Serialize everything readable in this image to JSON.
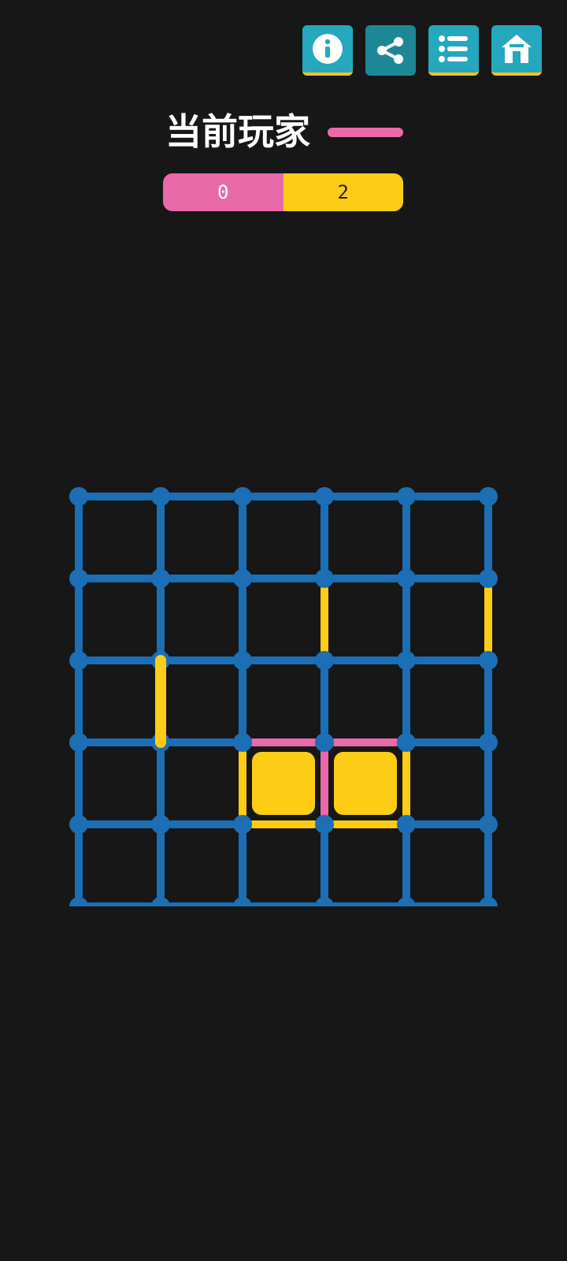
{
  "header": {
    "buttons": [
      {
        "name": "info-button",
        "icon": "info-icon"
      },
      {
        "name": "share-button",
        "icon": "share-icon"
      },
      {
        "name": "list-button",
        "icon": "list-icon"
      },
      {
        "name": "home-button",
        "icon": "home-icon"
      }
    ],
    "player_label": "当前玩家",
    "current_player": 1
  },
  "scores": {
    "player1": "0",
    "player2": "2"
  },
  "colors": {
    "background": "#171717",
    "grid_line": "#1c6fb5",
    "player1": "#e96aa8",
    "player2": "#fdcd15",
    "button": "#25a8bd",
    "button_dark": "#1e8797",
    "button_underline": "#f2c419"
  },
  "board": {
    "dots_per_side": 6,
    "horizontal_edges": [
      [
        0,
        0,
        0,
        0,
        0
      ],
      [
        0,
        0,
        0,
        0,
        0
      ],
      [
        0,
        0,
        0,
        0,
        0
      ],
      [
        0,
        0,
        1,
        1,
        0
      ],
      [
        0,
        0,
        2,
        2,
        0
      ],
      [
        0,
        0,
        0,
        0,
        0
      ]
    ],
    "vertical_edges": [
      [
        0,
        0,
        0,
        0,
        0,
        0
      ],
      [
        0,
        0,
        0,
        2,
        0,
        2
      ],
      [
        0,
        2,
        0,
        0,
        0,
        0
      ],
      [
        0,
        0,
        2,
        1,
        2,
        0
      ],
      [
        0,
        0,
        0,
        0,
        0,
        0
      ]
    ],
    "boxes": [
      [
        0,
        0,
        0,
        0,
        0
      ],
      [
        0,
        0,
        0,
        0,
        0
      ],
      [
        0,
        0,
        0,
        0,
        0
      ],
      [
        0,
        0,
        2,
        2,
        0
      ],
      [
        0,
        0,
        0,
        0,
        0
      ]
    ]
  }
}
